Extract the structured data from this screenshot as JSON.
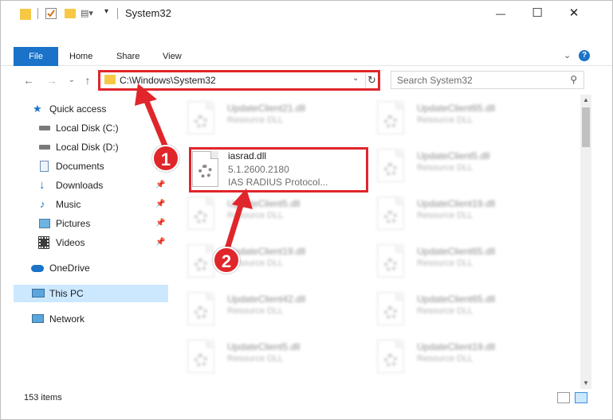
{
  "window": {
    "title": "System32",
    "controls": {
      "minimize": "—",
      "maximize": "☐",
      "close": "✕"
    }
  },
  "ribbon": {
    "tabs": [
      {
        "label": "File"
      },
      {
        "label": "Home"
      },
      {
        "label": "Share"
      },
      {
        "label": "View"
      }
    ]
  },
  "address_bar": {
    "path": "C:\\Windows\\System32"
  },
  "search": {
    "placeholder": "Search System32"
  },
  "sidebar": {
    "items": [
      {
        "label": "Quick access",
        "icon": "star-icon"
      },
      {
        "label": "Local Disk (C:)",
        "icon": "drive-icon",
        "pinned": true
      },
      {
        "label": "Local Disk (D:)",
        "icon": "drive-icon"
      },
      {
        "label": "Documents",
        "icon": "documents-icon",
        "pinned": true
      },
      {
        "label": "Downloads",
        "icon": "download-icon",
        "pinned": true
      },
      {
        "label": "Music",
        "icon": "music-icon",
        "pinned": true
      },
      {
        "label": "Pictures",
        "icon": "pictures-icon",
        "pinned": true
      },
      {
        "label": "Videos",
        "icon": "videos-icon",
        "pinned": true
      },
      {
        "label": "OneDrive",
        "icon": "cloud-icon"
      },
      {
        "label": "This PC",
        "icon": "computer-icon",
        "selected": true
      },
      {
        "label": "Network",
        "icon": "network-icon"
      }
    ]
  },
  "files_left": [
    {
      "name": "UpdateClient21.dll",
      "type": "Resource DLL"
    },
    {
      "name": "UpdateClient5.dll",
      "type": "Resource DLL"
    },
    {
      "name": "UpdateClient19.dll",
      "type": "Resource DLL"
    },
    {
      "name": "UpdateClient42.dll",
      "type": "Resource DLL"
    },
    {
      "name": "UpdateClient5.dll",
      "type": "Resource DLL"
    }
  ],
  "files_right": [
    {
      "name": "UpdateClient65.dll",
      "type": "Resource DLL"
    },
    {
      "name": "UpdateClient5.dll",
      "type": "Resource DLL"
    },
    {
      "name": "UpdateClient19.dll",
      "type": "Resource DLL"
    },
    {
      "name": "UpdateClient65.dll",
      "type": "Resource DLL"
    },
    {
      "name": "UpdateClient65.dll",
      "type": "Resource DLL"
    },
    {
      "name": "UpdateClient19.dll",
      "type": "Resource DLL"
    }
  ],
  "target_file": {
    "name": "iasrad.dll",
    "version": "5.1.2600.2180",
    "description": "IAS RADIUS Protocol..."
  },
  "status": {
    "item_count": "153 items"
  },
  "annotations": {
    "badge1": "1",
    "badge2": "2",
    "color": "#e0262b"
  }
}
